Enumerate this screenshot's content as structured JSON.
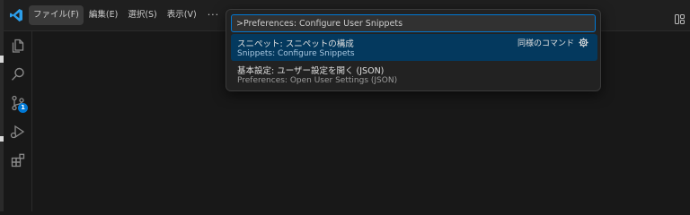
{
  "app": {
    "logo_icon": "vscode-logo-icon",
    "accent": "#0078d4"
  },
  "menu": {
    "items": [
      "ファイル(F)",
      "編集(E)",
      "選択(S)",
      "表示(V)"
    ],
    "more_label": "···"
  },
  "activity_bar": {
    "items": [
      {
        "name": "explorer",
        "icon": "files-icon"
      },
      {
        "name": "search",
        "icon": "search-icon"
      },
      {
        "name": "source-control",
        "icon": "source-control-icon",
        "badge": "1"
      },
      {
        "name": "run-debug",
        "icon": "run-debug-icon"
      },
      {
        "name": "extensions",
        "icon": "extensions-icon"
      }
    ]
  },
  "command_palette": {
    "input_value": ">Preferences: Configure User Snippets",
    "results": [
      {
        "label": "スニペット: スニペットの構成",
        "detail": "Snippets: Configure Snippets",
        "group": "同様のコマンド",
        "selected": true
      },
      {
        "label": "基本設定: ユーザー設定を開く (JSON)",
        "detail": "Preferences: Open User Settings (JSON)",
        "selected": false
      }
    ]
  }
}
